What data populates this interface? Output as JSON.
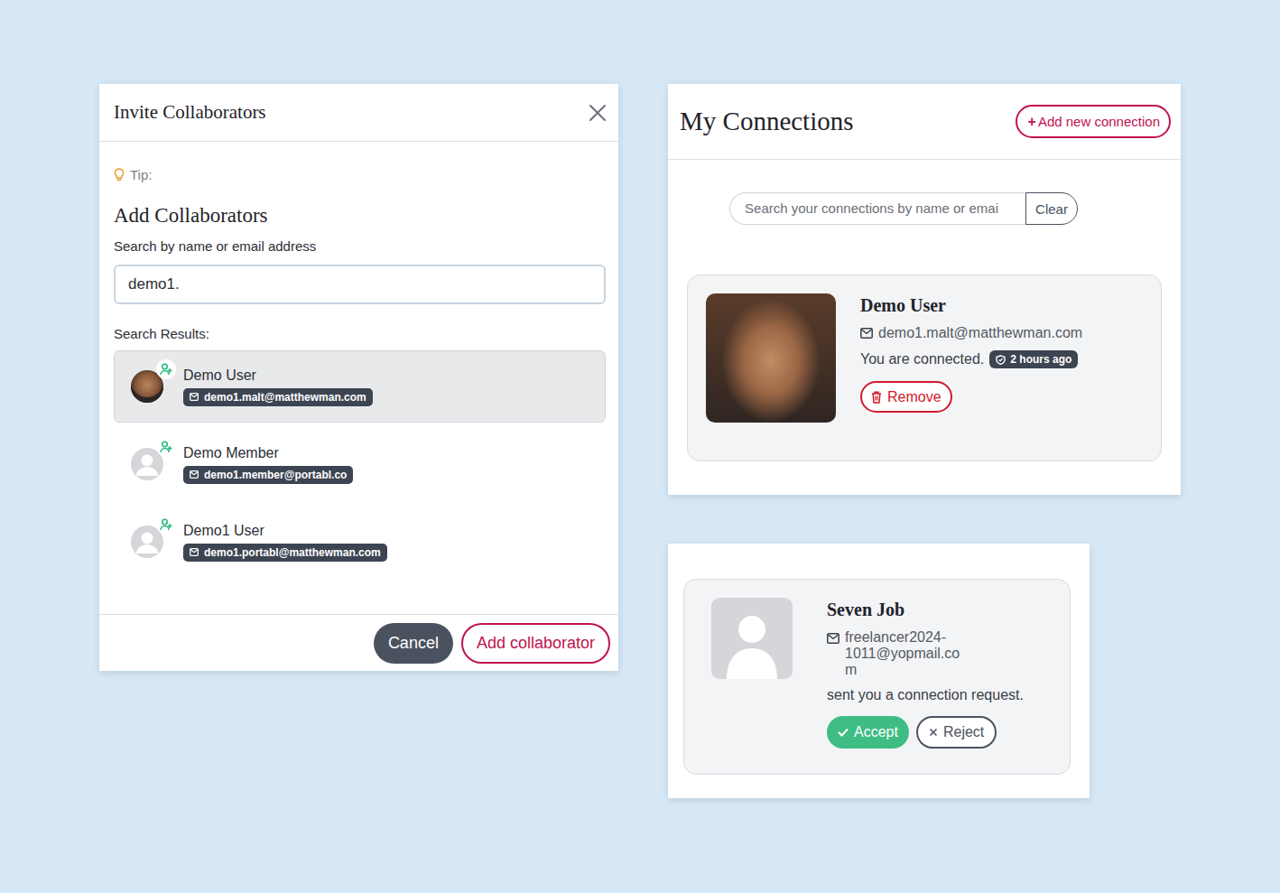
{
  "invite_dialog": {
    "title": "Invite Collaborators",
    "tip": "Tip:",
    "heading": "Add Collaborators",
    "search_label": "Search by name or email address",
    "search_value": "demo1.",
    "results_label": "Search Results:",
    "results": [
      {
        "name": "Demo User",
        "email": "demo1.malt@matthewman.com",
        "photo": true,
        "selected": true
      },
      {
        "name": "Demo Member",
        "email": "demo1.member@portabl.co",
        "photo": false,
        "selected": false
      },
      {
        "name": "Demo1 User",
        "email": "demo1.portabl@matthewman.com",
        "photo": false,
        "selected": false
      }
    ],
    "buttons": {
      "cancel": "Cancel",
      "confirm": "Add collaborator"
    }
  },
  "connections": {
    "title": "My Connections",
    "add_icon": "+",
    "add_button": "Add new connection",
    "search": {
      "placeholder": "Search your connections by name or emai",
      "clear": "Clear"
    },
    "items": [
      {
        "name": "Demo User",
        "email": "demo1.malt@matthewman.com",
        "status": "You are connected.",
        "time": "2 hours ago",
        "action": "Remove",
        "photo": true
      }
    ]
  },
  "request": {
    "name": "Seven Job",
    "email": "freelancer2024-1011@yopmail.com",
    "message": "sent you a connection request.",
    "accept": "Accept",
    "reject": "Reject",
    "photo": false
  }
}
